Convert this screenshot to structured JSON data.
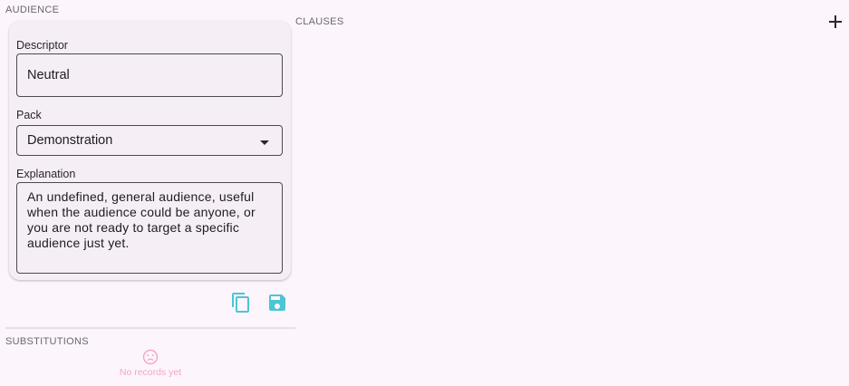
{
  "audience": {
    "section_label": "AUDIENCE",
    "descriptor": {
      "label": "Descriptor",
      "value": "Neutral"
    },
    "pack": {
      "label": "Pack",
      "value": "Demonstration"
    },
    "explanation": {
      "label": "Explanation",
      "value": "An undefined, general audience, useful when the audience could be anyone, or you are not ready to target a specific audience just yet."
    },
    "actions": {
      "copy_icon": "copy-icon",
      "save_icon": "save-icon"
    }
  },
  "substitutions": {
    "section_label": "SUBSTITUTIONS",
    "empty_icon": "sad-face-icon",
    "empty_text": "No records yet"
  },
  "clauses": {
    "section_label": "CLAUSES",
    "add_icon": "plus-icon"
  },
  "colors": {
    "background": "#fcf5fb",
    "card": "#f5eff5",
    "accent": "#4cc5d4",
    "empty": "#f3a6c4"
  }
}
